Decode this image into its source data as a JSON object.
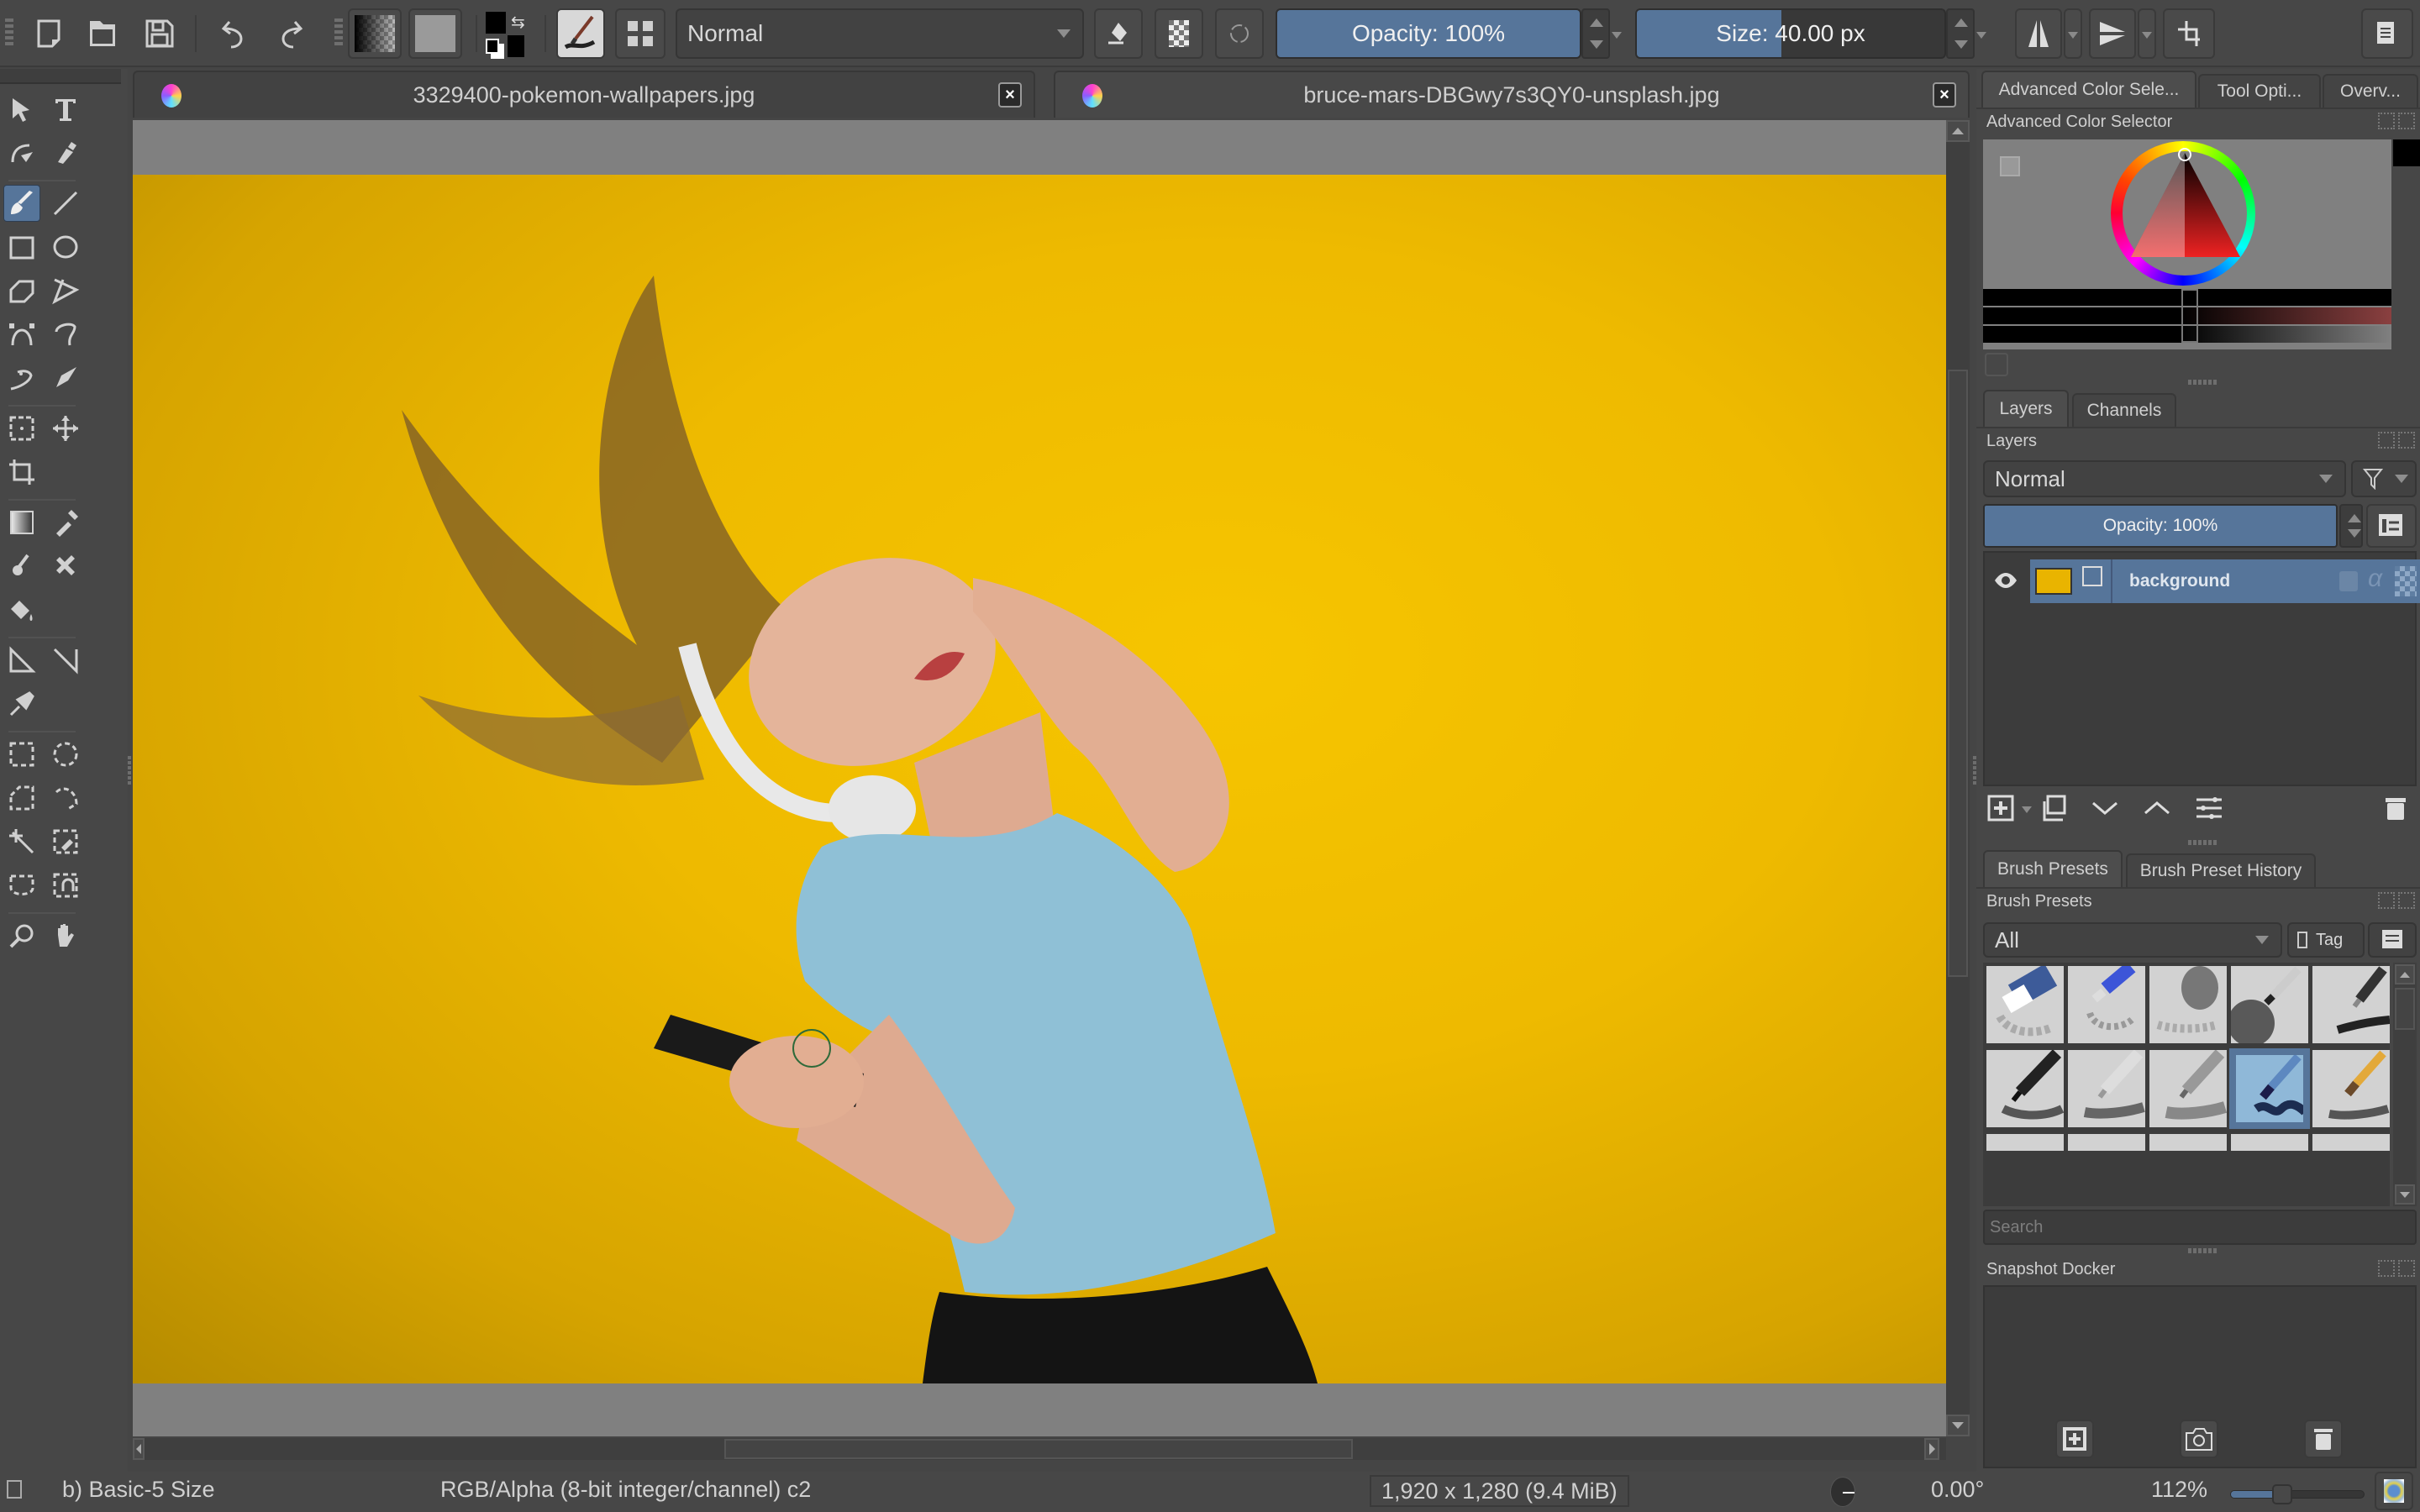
{
  "toolbar": {
    "buttons": [
      {
        "name": "new-document-icon"
      },
      {
        "name": "open-document-icon"
      },
      {
        "name": "save-icon"
      },
      {
        "name": "undo-icon"
      },
      {
        "name": "redo-icon"
      }
    ],
    "gradient_preset": "gradient-swatch",
    "pattern_preset": "pattern-swatch",
    "foreground_color": "#000000",
    "background_color": "#000000",
    "blend_mode": "Normal",
    "opacity_label": "Opacity: 100%",
    "opacity_value": 100,
    "size_label": "Size: 40.00 px",
    "size_fill_fraction": 0.47
  },
  "tabs": [
    {
      "title": "3329400-pokemon-wallpapers.jpg",
      "close": "×",
      "active": false
    },
    {
      "title": "bruce-mars-DBGwy7s3QY0-unsplash.jpg",
      "close": "×",
      "active": true
    }
  ],
  "tools": [
    {
      "name": "select-shapes-tool"
    },
    {
      "name": "text-tool"
    },
    {
      "name": "edit-shapes-tool"
    },
    {
      "name": "calligraphy-tool"
    },
    {
      "name": "freehand-brush-tool",
      "active": true
    },
    {
      "name": "line-tool"
    },
    {
      "name": "rectangle-tool"
    },
    {
      "name": "ellipse-tool"
    },
    {
      "name": "polygon-tool"
    },
    {
      "name": "polyline-tool"
    },
    {
      "name": "bezier-curve-tool"
    },
    {
      "name": "freehand-path-tool"
    },
    {
      "name": "dynamic-brush-tool"
    },
    {
      "name": "multibrush-tool"
    },
    {
      "name": "transform-tool"
    },
    {
      "name": "move-tool"
    },
    {
      "name": "crop-tool"
    },
    {
      "name": "gradient-tool"
    },
    {
      "name": "color-picker-tool"
    },
    {
      "name": "smart-patch-tool"
    },
    {
      "name": "clone-tool"
    },
    {
      "name": "fill-tool"
    },
    {
      "name": "assistant-tool"
    },
    {
      "name": "measure-tool"
    },
    {
      "name": "reference-images-tool"
    },
    {
      "name": "rectangular-selection-tool"
    },
    {
      "name": "elliptical-selection-tool"
    },
    {
      "name": "polygonal-selection-tool"
    },
    {
      "name": "freehand-selection-tool"
    },
    {
      "name": "contiguous-selection-tool"
    },
    {
      "name": "similar-color-selection-tool"
    },
    {
      "name": "bezier-selection-tool"
    },
    {
      "name": "magnetic-selection-tool"
    },
    {
      "name": "zoom-tool"
    },
    {
      "name": "pan-tool"
    }
  ],
  "docker": {
    "top_tabs": [
      "Advanced Color Sele...",
      "Tool Opti...",
      "Overv..."
    ],
    "color_selector_title": "Advanced Color Selector",
    "layers_tabs": [
      "Layers",
      "Channels"
    ],
    "layers_title": "Layers",
    "layer_blend_mode": "Normal",
    "layer_opacity_label": "Opacity:  100%",
    "layers": [
      {
        "name": "background",
        "visible": true,
        "selected": true
      }
    ],
    "brush_tabs": [
      "Brush Presets",
      "Brush Preset History"
    ],
    "brush_title": "Brush Presets",
    "brush_filter": "All",
    "tag_label": "Tag",
    "brush_search_placeholder": "Search",
    "presets": [
      {
        "name": "eraser-circle"
      },
      {
        "name": "eraser-small"
      },
      {
        "name": "eraser-soft"
      },
      {
        "name": "airbrush-soft"
      },
      {
        "name": "ink-pen"
      },
      {
        "name": "pencil-dark"
      },
      {
        "name": "pencil-light"
      },
      {
        "name": "pencil-grey"
      },
      {
        "name": "brush-ink-blue",
        "selected": true
      },
      {
        "name": "brush-paint"
      }
    ],
    "snapshot_title": "Snapshot Docker"
  },
  "status": {
    "brush_preset": "b) Basic-5 Size",
    "color_space": "RGB/Alpha (8-bit integer/channel)  c2",
    "image_size": "1,920 x 1,280 (9.4 MiB)",
    "rotation": "0.00°",
    "zoom": "112%",
    "zoom_fraction": 0.37
  }
}
